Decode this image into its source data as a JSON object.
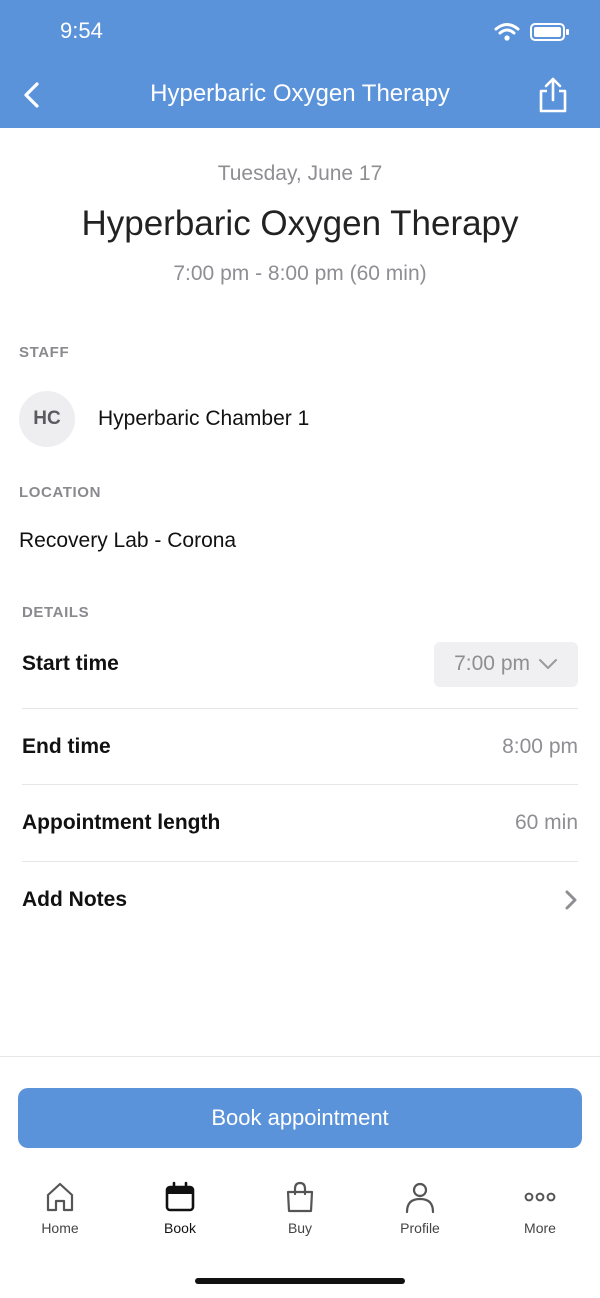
{
  "status_bar": {
    "time": "9:54"
  },
  "nav": {
    "title": "Hyperbaric Oxygen Therapy"
  },
  "appointment": {
    "date": "Tuesday, June 17",
    "title": "Hyperbaric Oxygen Therapy",
    "time_range": "7:00 pm - 8:00 pm (60 min)"
  },
  "staff": {
    "section_label": "STAFF",
    "initials": "HC",
    "name": "Hyperbaric Chamber 1"
  },
  "location": {
    "section_label": "LOCATION",
    "name": "Recovery Lab - Corona"
  },
  "details": {
    "section_label": "DETAILS",
    "start_time": {
      "label": "Start time",
      "value": "7:00 pm"
    },
    "end_time": {
      "label": "End time",
      "value": "8:00 pm"
    },
    "length": {
      "label": "Appointment length",
      "value": "60 min"
    },
    "notes": {
      "label": "Add Notes"
    }
  },
  "book_button": {
    "label": "Book appointment"
  },
  "tabs": [
    {
      "label": "Home",
      "icon": "home-icon",
      "active": false
    },
    {
      "label": "Book",
      "icon": "calendar-icon",
      "active": true
    },
    {
      "label": "Buy",
      "icon": "shopping-bag-icon",
      "active": false
    },
    {
      "label": "Profile",
      "icon": "person-icon",
      "active": false
    },
    {
      "label": "More",
      "icon": "more-dots-icon",
      "active": false
    }
  ],
  "colors": {
    "accent": "#5b93db",
    "muted_text": "#8e8e93",
    "divider": "#e5e5ea"
  }
}
